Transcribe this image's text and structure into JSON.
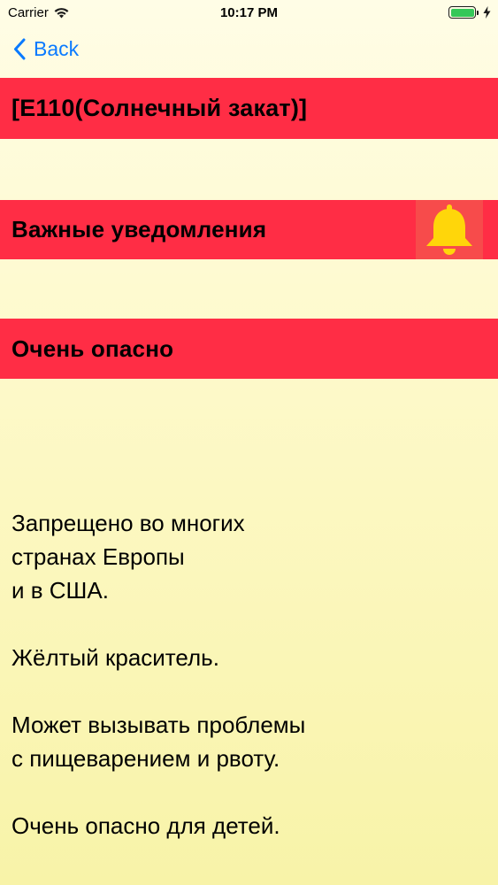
{
  "status_bar": {
    "carrier": "Carrier",
    "time": "10:17 PM",
    "battery_level": 1.0
  },
  "nav": {
    "back_label": "Back"
  },
  "product_title": "[E110(Солнечный закат)]",
  "notifications_label": "Важные уведомления",
  "danger_label": "Очень опасно",
  "description": {
    "p1_l1": "Запрещено во многих",
    "p1_l2": "странах Европы",
    "p1_l3": "и в США.",
    "p2": "Жёлтый краситель.",
    "p3_l1": "Может вызывать проблемы",
    "p3_l2": "с пищеварением и рвоту.",
    "p4": "Очень опасно для детей."
  },
  "colors": {
    "band_red": "#ff2d45",
    "bell_bg": "#f74b4b",
    "bell_yellow": "#ffd60a",
    "link_blue": "#0a7aff",
    "battery_green": "#34c759"
  }
}
